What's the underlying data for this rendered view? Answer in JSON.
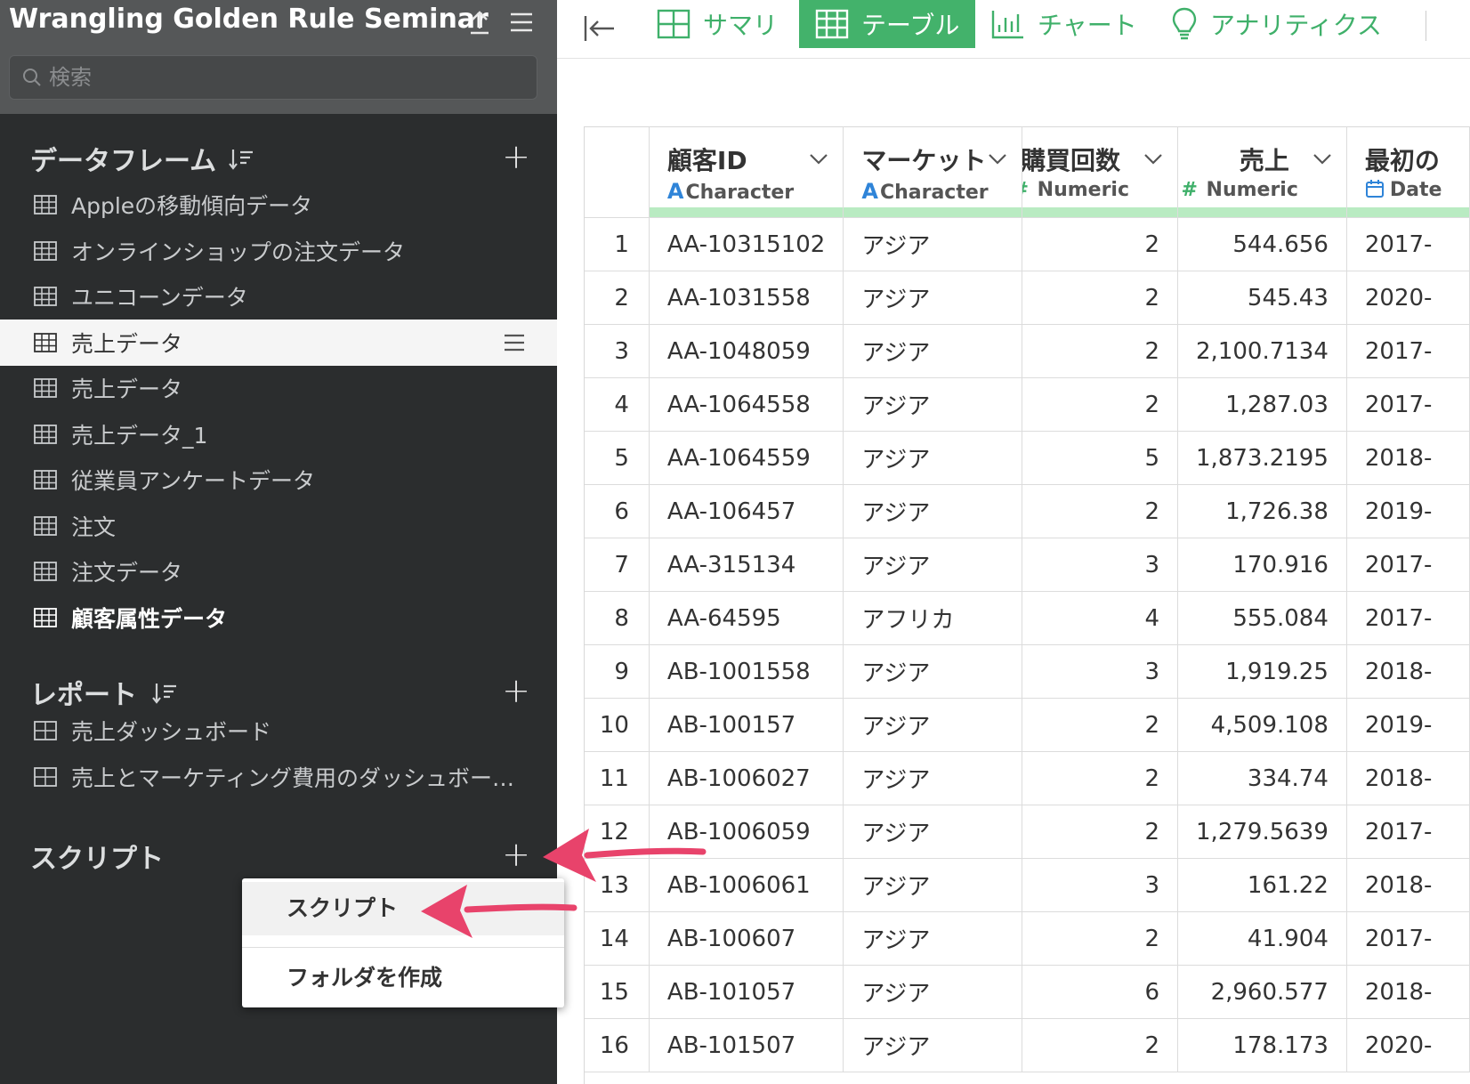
{
  "project": {
    "title": "Wrangling Golden Rule Seminar"
  },
  "search": {
    "placeholder": "検索"
  },
  "sections": {
    "dataframes": {
      "title": "データフレーム",
      "items": [
        "Appleの移動傾向データ",
        "オンラインショップの注文データ",
        "ユニコーンデータ",
        "売上データ",
        "売上データ",
        "売上データ_1",
        "従業員アンケートデータ",
        "注文",
        "注文データ",
        "顧客属性データ"
      ]
    },
    "reports": {
      "title": "レポート",
      "items": [
        "売上ダッシュボード",
        "売上とマーケティング費用のダッシュボー…"
      ]
    },
    "scripts": {
      "title": "スクリプト"
    }
  },
  "context_menu": {
    "script": "スクリプト",
    "create_folder": "フォルダを作成"
  },
  "tabs": {
    "summary": "サマリ",
    "table": "テーブル",
    "chart": "チャート",
    "analytics": "アナリティクス"
  },
  "columns": [
    {
      "name": "顧客ID",
      "type": "Character",
      "mark": "A"
    },
    {
      "name": "マーケット",
      "type": "Character",
      "mark": "A"
    },
    {
      "name": "購買回数",
      "type": "Numeric",
      "mark": "#"
    },
    {
      "name": "売上",
      "type": "Numeric",
      "mark": "#"
    },
    {
      "name": "最初の",
      "type": "Date",
      "mark": ""
    }
  ],
  "rows": [
    [
      "1",
      "AA-10315102",
      "アジア",
      "2",
      "544.656",
      "2017-"
    ],
    [
      "2",
      "AA-1031558",
      "アジア",
      "2",
      "545.43",
      "2020-"
    ],
    [
      "3",
      "AA-1048059",
      "アジア",
      "2",
      "2,100.7134",
      "2017-"
    ],
    [
      "4",
      "AA-1064558",
      "アジア",
      "2",
      "1,287.03",
      "2017-"
    ],
    [
      "5",
      "AA-1064559",
      "アジア",
      "5",
      "1,873.2195",
      "2018-"
    ],
    [
      "6",
      "AA-106457",
      "アジア",
      "2",
      "1,726.38",
      "2019-"
    ],
    [
      "7",
      "AA-315134",
      "アジア",
      "3",
      "170.916",
      "2017-"
    ],
    [
      "8",
      "AA-64595",
      "アフリカ",
      "4",
      "555.084",
      "2017-"
    ],
    [
      "9",
      "AB-1001558",
      "アジア",
      "3",
      "1,919.25",
      "2018-"
    ],
    [
      "10",
      "AB-100157",
      "アジア",
      "2",
      "4,509.108",
      "2019-"
    ],
    [
      "11",
      "AB-1006027",
      "アジア",
      "2",
      "334.74",
      "2018-"
    ],
    [
      "12",
      "AB-1006059",
      "アジア",
      "2",
      "1,279.5639",
      "2017-"
    ],
    [
      "13",
      "AB-1006061",
      "アジア",
      "3",
      "161.22",
      "2018-"
    ],
    [
      "14",
      "AB-100607",
      "アジア",
      "2",
      "41.904",
      "2017-"
    ],
    [
      "15",
      "AB-101057",
      "アジア",
      "6",
      "2,960.577",
      "2018-"
    ],
    [
      "16",
      "AB-101507",
      "アジア",
      "2",
      "178.173",
      "2020-"
    ]
  ],
  "colors": {
    "accent": "#43b26b",
    "arrow": "#e8436b",
    "sidebar": "#2b2d2e"
  }
}
